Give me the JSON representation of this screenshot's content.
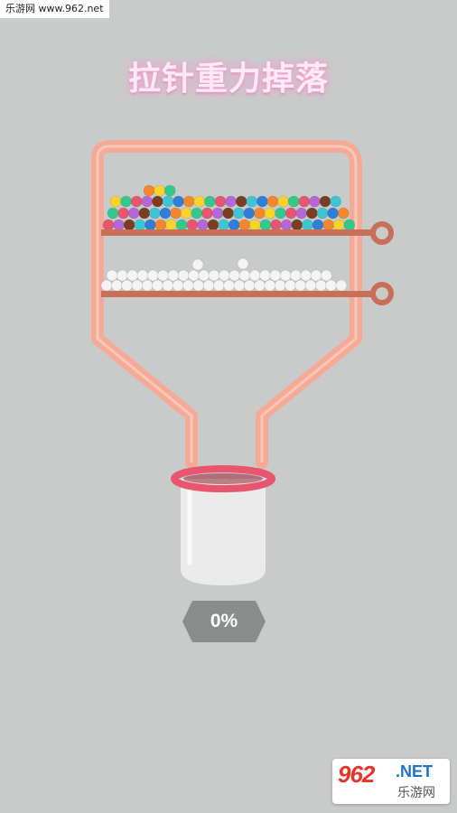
{
  "watermark_top": "乐游网 www.962.net",
  "game_title": "拉针重力掉落",
  "progress_label": "0%",
  "logo": {
    "brand": "962",
    "suffix": ".NET",
    "cn": "乐游网"
  },
  "colors": {
    "background": "#c9cbca",
    "container": "#f5aa95",
    "pin": "#c86f58",
    "cup_rim": "#e9546e",
    "white_ball": "#f4f4f4"
  },
  "balls": {
    "colored_count": 72,
    "white_count": 48,
    "colored_palette": [
      "#e8556f",
      "#3ec5d4",
      "#f6d42a",
      "#b567d8",
      "#2f7fd8",
      "#33c98c",
      "#7a3d1f",
      "#f5862c"
    ]
  }
}
